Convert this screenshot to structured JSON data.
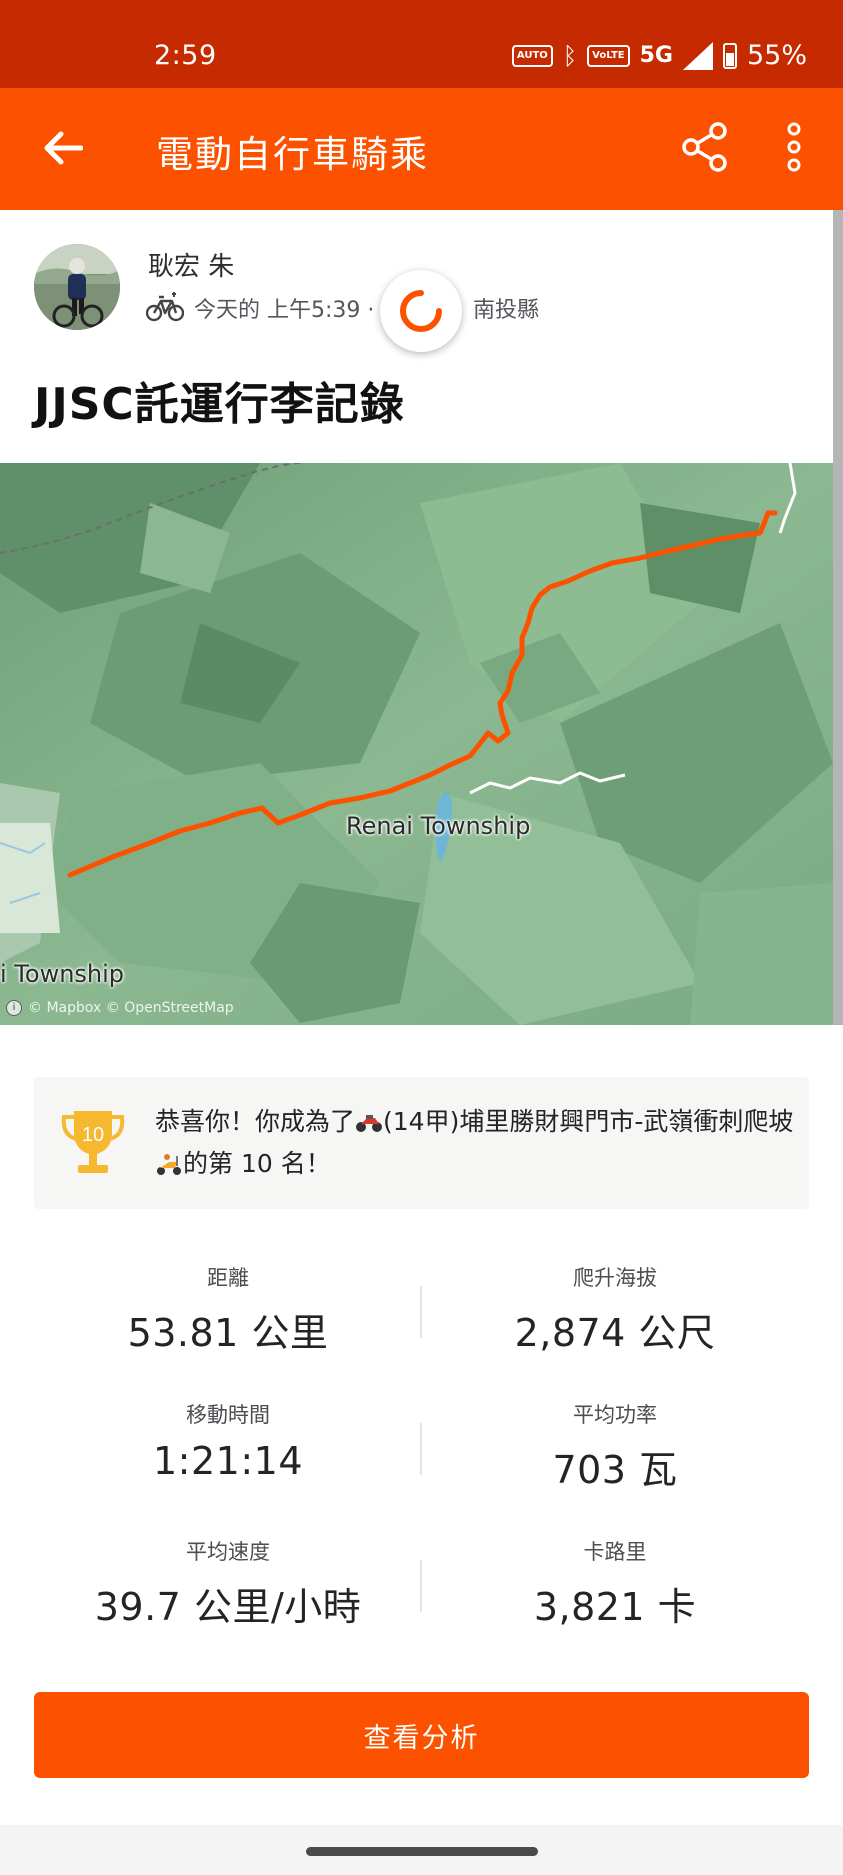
{
  "status_bar": {
    "time": "2:59",
    "auto_label": "AUTO",
    "volte_label": "VoLTE",
    "network": "5G",
    "battery": "55%"
  },
  "app_bar": {
    "title": "電動自行車騎乘"
  },
  "athlete": {
    "name": "耿宏 朱",
    "meta_time": "今天的 上午5:39 ·",
    "meta_location": "南投縣"
  },
  "activity": {
    "title": "JJSC託運行李記錄"
  },
  "map": {
    "label_renai": "Renai Township",
    "label_township": "i Township",
    "attribution": "© Mapbox © OpenStreetMap",
    "route_color": "#fc5200"
  },
  "achievement": {
    "rank_badge": "10",
    "text_before": "恭喜你！你成為了",
    "segment_name": "(14甲)埔里勝財興門市-武嶺衝刺爬坡",
    "text_after": "的第 10 名！"
  },
  "stats": [
    {
      "label": "距離",
      "value": "53.81 公里"
    },
    {
      "label": "爬升海拔",
      "value": "2,874 公尺"
    },
    {
      "label": "移動時間",
      "value": "1:21:14"
    },
    {
      "label": "平均功率",
      "value": "703 瓦"
    },
    {
      "label": "平均速度",
      "value": "39.7 公里/小時"
    },
    {
      "label": "卡路里",
      "value": "3,821 卡"
    }
  ],
  "actions": {
    "analysis_label": "查看分析"
  },
  "colors": {
    "brand": "#fc5200",
    "status_bar": "#c62a00",
    "trophy": "#f5b82e"
  }
}
